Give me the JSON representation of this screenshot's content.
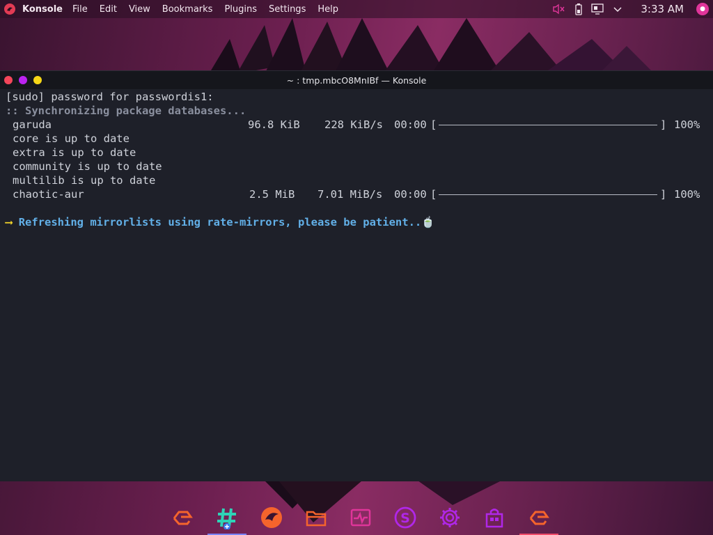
{
  "top_panel": {
    "app_name": "Konsole",
    "menu": [
      "File",
      "Edit",
      "View",
      "Bookmarks",
      "Plugins",
      "Settings",
      "Help"
    ],
    "clock": "3:33 AM",
    "tray_icons": [
      "volume-muted-icon",
      "battery-icon",
      "network-icon",
      "chevron-down-icon"
    ]
  },
  "window": {
    "title": "~ : tmp.mbcO8MnIBf — Konsole"
  },
  "terminal": {
    "prompt_line": "[sudo] password for passwordis1:",
    "sync_line": ":: Synchronizing package databases...",
    "downloads": [
      {
        "name": "garuda",
        "size": "96.8 KiB",
        "speed": "228 KiB/s",
        "time": "00:00",
        "percent": "100%"
      },
      {
        "name": "chaotic-aur",
        "size": "2.5 MiB",
        "speed": "7.01 MiB/s",
        "time": "00:00",
        "percent": "100%"
      }
    ],
    "status_lines": [
      "core is up to date",
      "extra is up to date",
      "community is up to date",
      "multilib is up to date"
    ],
    "arrow": "⟶",
    "refresh_text": "Refreshing mirrorlists using rate-mirrors, please be patient..",
    "refresh_emoji": "🍵"
  },
  "dock": {
    "items": [
      {
        "icon": "garuda-logo-icon",
        "color": "#f5642c"
      },
      {
        "icon": "hashtag-icon",
        "color": "#2ed3b7"
      },
      {
        "icon": "dragon-icon",
        "color": "#f5642c"
      },
      {
        "icon": "folder-icon",
        "color": "#f5642c"
      },
      {
        "icon": "system-monitor-icon",
        "color": "#e0359a"
      },
      {
        "icon": "s-badge-icon",
        "color": "#b027e8"
      },
      {
        "icon": "gear-icon",
        "color": "#b027e8"
      },
      {
        "icon": "store-icon",
        "color": "#b027e8"
      },
      {
        "icon": "garuda-logo-icon",
        "color": "#f5642c"
      }
    ],
    "active_colors": {
      "second": "#7a83ff",
      "last": "#f14c6a"
    }
  },
  "colors": {
    "terminal_bg": "#1e2029",
    "accent_cyan": "#62b0e8",
    "accent_yellow": "#f2d42a"
  }
}
